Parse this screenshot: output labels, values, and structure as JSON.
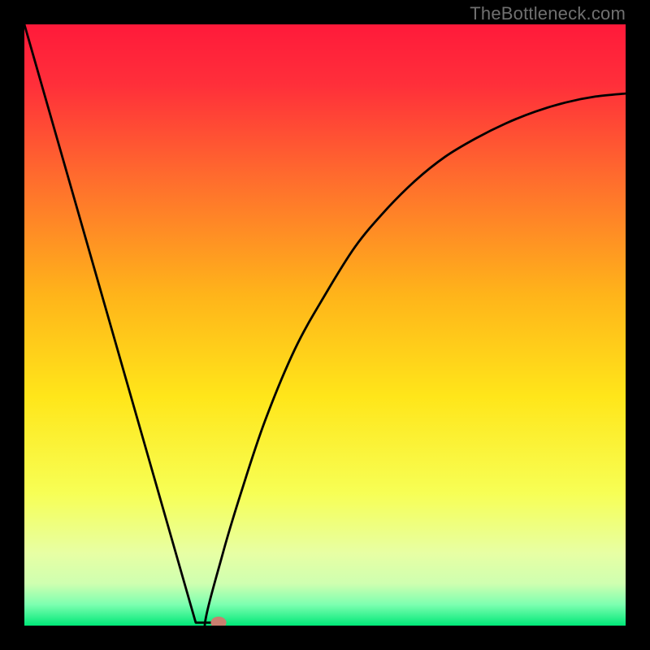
{
  "watermark": "TheBottleneck.com",
  "colors": {
    "black": "#000000",
    "gradient_stops": [
      {
        "offset": 0.0,
        "color": "#ff1a3a"
      },
      {
        "offset": 0.1,
        "color": "#ff2f3a"
      },
      {
        "offset": 0.25,
        "color": "#ff6a2e"
      },
      {
        "offset": 0.45,
        "color": "#ffb41a"
      },
      {
        "offset": 0.62,
        "color": "#ffe61a"
      },
      {
        "offset": 0.78,
        "color": "#f7ff55"
      },
      {
        "offset": 0.88,
        "color": "#e7ffa4"
      },
      {
        "offset": 0.93,
        "color": "#cfffb0"
      },
      {
        "offset": 0.965,
        "color": "#7dffb0"
      },
      {
        "offset": 1.0,
        "color": "#00e878"
      }
    ],
    "curve": "#000000",
    "marker": "#c97f6f"
  },
  "chart_data": {
    "type": "line",
    "title": "",
    "xlabel": "",
    "ylabel": "",
    "xlim": [
      0,
      1
    ],
    "ylim": [
      0,
      1
    ],
    "left_line": {
      "x": [
        0.0,
        0.3
      ],
      "y": [
        1.0,
        0.0
      ]
    },
    "right_curve_x": [
      0.3,
      0.33,
      0.36,
      0.4,
      0.45,
      0.5,
      0.55,
      0.6,
      0.65,
      0.7,
      0.75,
      0.8,
      0.85,
      0.9,
      0.95,
      1.0
    ],
    "right_curve_y": [
      0.0,
      0.12,
      0.22,
      0.34,
      0.46,
      0.55,
      0.63,
      0.69,
      0.74,
      0.78,
      0.81,
      0.835,
      0.855,
      0.87,
      0.88,
      0.885
    ],
    "flat_bottom": {
      "x": [
        0.285,
        0.325
      ],
      "y": [
        0.005,
        0.005
      ]
    },
    "marker": {
      "x": 0.323,
      "y": 0.005,
      "rx": 0.013,
      "ry": 0.01
    }
  }
}
